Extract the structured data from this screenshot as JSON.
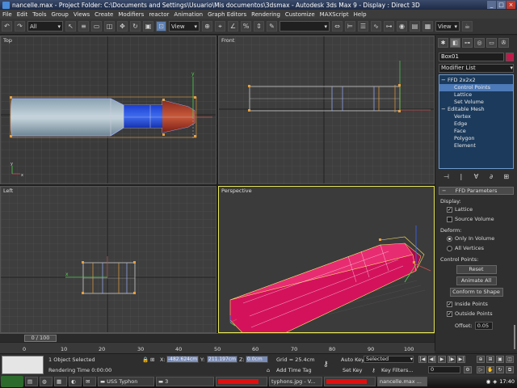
{
  "window": {
    "title": "nancelle.max  - Project Folder: C:\\Documents and Settings\\Usuario\\Mis documentos\\3dsmax  - Autodesk 3ds Max 9  - Display : Direct 3D",
    "min": "_",
    "max": "□",
    "close": "×"
  },
  "menu": [
    "File",
    "Edit",
    "Tools",
    "Group",
    "Views",
    "Create",
    "Modifiers",
    "reactor",
    "Animation",
    "Graph Editors",
    "Rendering",
    "Customize",
    "MAXScript",
    "Help"
  ],
  "toolbar": {
    "filter_dropdown": "All",
    "ref_coord_dropdown": "View",
    "named_sel_dropdown": "",
    "right_dropdown": "View"
  },
  "viewports": {
    "top": "Top",
    "front": "Front",
    "left": "Left",
    "perspective": "Perspective"
  },
  "command_panel": {
    "object_name": "Box01",
    "object_color": "#c01a4a",
    "modifier_list": "Modifier List",
    "stack": [
      {
        "label": "FFD 2x2x2",
        "level": 0,
        "prefix": "−"
      },
      {
        "label": "Control Points",
        "level": 1,
        "selected": true
      },
      {
        "label": "Lattice",
        "level": 1
      },
      {
        "label": "Set Volume",
        "level": 1
      },
      {
        "label": "Editable Mesh",
        "level": 0,
        "prefix": "−"
      },
      {
        "label": "Vertex",
        "level": 1
      },
      {
        "label": "Edge",
        "level": 1
      },
      {
        "label": "Face",
        "level": 1
      },
      {
        "label": "Polygon",
        "level": 1
      },
      {
        "label": "Element",
        "level": 1
      }
    ],
    "stack_buttons": [
      "⊣",
      "|",
      "∀",
      "∂",
      "⊞"
    ],
    "ffd": {
      "rollout_title": "FFD Parameters",
      "display_label": "Display:",
      "lattice": "Lattice",
      "lattice_checked": true,
      "source_volume": "Source Volume",
      "source_volume_checked": false,
      "deform_label": "Deform:",
      "only_in_volume": "Only In Volume",
      "all_vertices": "All Vertices",
      "control_points_label": "Control Points:",
      "reset": "Reset",
      "animate_all": "Animate All",
      "conform_to_shape": "Conform to Shape",
      "inside_points": "Inside Points",
      "inside_points_checked": true,
      "outside_points": "Outside Points",
      "outside_points_checked": true,
      "offset_label": "Offset:",
      "offset_value": "0.05"
    }
  },
  "timeline": {
    "slider_label": "0 / 100",
    "ticks": [
      "0",
      "10",
      "20",
      "30",
      "40",
      "50",
      "60",
      "70",
      "80",
      "90",
      "100"
    ]
  },
  "status": {
    "selection": "1 Object Selected",
    "rendering_time": "Rendering Time  0:00:00",
    "x_label": "X:",
    "x_value": "-482.624cm",
    "y_label": "Y:",
    "y_value": "211.197cm",
    "z_label": "Z:",
    "z_value": "0.0cm",
    "grid": "Grid = 25.4cm",
    "add_time_tag": "Add Time Tag",
    "auto_key": "Auto Key",
    "selected_dd": "Selected",
    "set_key": "Set Key",
    "key_filters": "Key Filters...",
    "frame": "0"
  },
  "taskbar": {
    "items": [
      "USS Typhon",
      "3",
      "",
      "typhons.jpg - V...",
      "",
      "nancelle.max ..."
    ],
    "clock": "17:40"
  }
}
